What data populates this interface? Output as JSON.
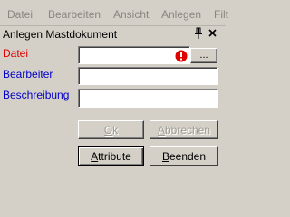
{
  "menubar": {
    "items": [
      {
        "label": "Datei"
      },
      {
        "label": "Bearbeiten"
      },
      {
        "label": "Ansicht"
      },
      {
        "label": "Anlegen"
      },
      {
        "label": "Filt"
      }
    ]
  },
  "panel": {
    "title": "Anlegen Mastdokument",
    "pin_icon": "pin-icon",
    "close_icon": "close-icon"
  },
  "form": {
    "datei_label": "Datei",
    "datei_value": "",
    "browse_label": "...",
    "error_icon": "error-icon",
    "bearbeiter_label": "Bearbeiter",
    "bearbeiter_value": "",
    "beschreibung_label": "Beschreibung",
    "beschreibung_value": ""
  },
  "buttons": {
    "ok_first": "O",
    "ok_rest": "k",
    "abbrechen_first": "A",
    "abbrechen_rest": "bbrechen",
    "attribute_first": "A",
    "attribute_rest": "ttribute",
    "beenden_first": "B",
    "beenden_rest": "eenden"
  },
  "colors": {
    "required_label": "#e00000",
    "optional_label": "#0000c8",
    "error_icon": "#e00000",
    "background": "#d4d0c8"
  }
}
